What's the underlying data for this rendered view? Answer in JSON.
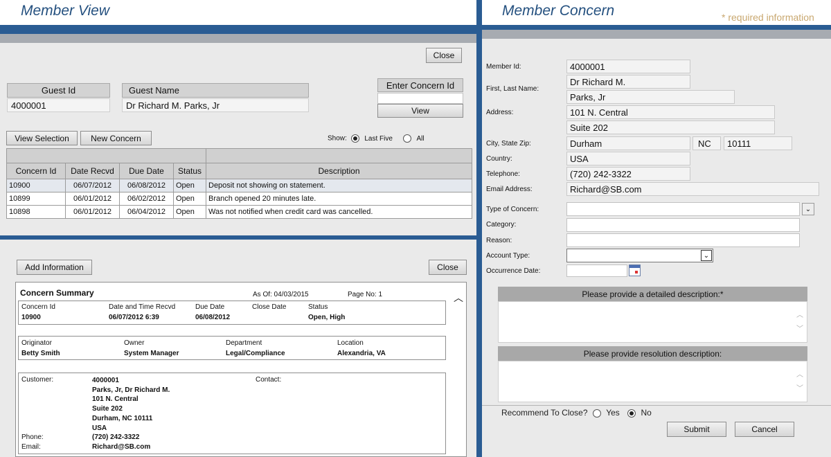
{
  "left": {
    "title": "Member View",
    "close_label": "Close",
    "guest_id_header": "Guest Id",
    "guest_id_value": "4000001",
    "guest_name_header": "Guest Name",
    "guest_name_value": "Dr Richard M. Parks, Jr",
    "enter_concern_label": "Enter Concern Id",
    "view_label": "View",
    "view_selection_label": "View Selection",
    "new_concern_label": "New Concern",
    "show_label": "Show:",
    "last_five_label": "Last Five",
    "all_label": "All",
    "table": {
      "headers": [
        "Concern Id",
        "Date Recvd",
        "Due Date",
        "Status",
        "Description"
      ],
      "rows": [
        [
          "10900",
          "06/07/2012",
          "06/08/2012",
          "Open",
          "Deposit not showing on statement."
        ],
        [
          "10899",
          "06/01/2012",
          "06/02/2012",
          "Open",
          "Branch opened 20 minutes late."
        ],
        [
          "10898",
          "06/01/2012",
          "06/04/2012",
          "Open",
          "Was not notified when credit card was cancelled."
        ]
      ]
    }
  },
  "summary": {
    "add_info_label": "Add Information",
    "close_label": "Close",
    "title": "Concern Summary",
    "as_of": "As Of: 04/03/2015",
    "page_no": "Page No: 1",
    "concern_id_label": "Concern Id",
    "concern_id": "10900",
    "date_recvd_label": "Date and Time Recvd",
    "date_recvd": "06/07/2012 6:39",
    "due_date_label": "Due Date",
    "due_date": "06/08/2012",
    "close_date_label": "Close Date",
    "status_label": "Status",
    "status": "Open, High",
    "originator_label": "Originator",
    "originator": "Betty Smith",
    "owner_label": "Owner",
    "owner": "System Manager",
    "department_label": "Department",
    "department": "Legal/Compliance",
    "location_label": "Location",
    "location": "Alexandria, VA",
    "customer_label": "Customer:",
    "customer_lines": [
      "4000001",
      "Parks, Jr, Dr Richard M.",
      "101 N. Central",
      "Suite 202",
      "Durham, NC 10111",
      "USA"
    ],
    "contact_label": "Contact:",
    "phone_label": "Phone:",
    "phone": "(720) 242-3322",
    "email_label": "Email:",
    "email": "Richard@SB.com"
  },
  "right": {
    "title": "Member Concern",
    "required_note": "* required information",
    "member_id_label": "Member Id:",
    "member_id": "4000001",
    "name_label": "First, Last Name:",
    "first_name": "Dr Richard M.",
    "last_name": "Parks, Jr",
    "address_label": "Address:",
    "address1": "101 N. Central",
    "address2": "Suite 202",
    "city_label": "City, State Zip:",
    "city": "Durham",
    "state": "NC",
    "zip": "10111",
    "country_label": "Country:",
    "country": "USA",
    "telephone_label": "Telephone:",
    "telephone": "(720) 242-3322",
    "email_label": "Email Address:",
    "email": "Richard@SB.com",
    "type_label": "Type of Concern:",
    "category_label": "Category:",
    "reason_label": "Reason:",
    "account_type_label": "Account Type:",
    "occurrence_label": "Occurrence Date:",
    "detail_header": "Please provide a detailed description:*",
    "resolution_header": "Please provide resolution description:",
    "recommend_label": "Recommend To Close?",
    "yes_label": "Yes",
    "no_label": "No",
    "submit_label": "Submit",
    "cancel_label": "Cancel"
  }
}
